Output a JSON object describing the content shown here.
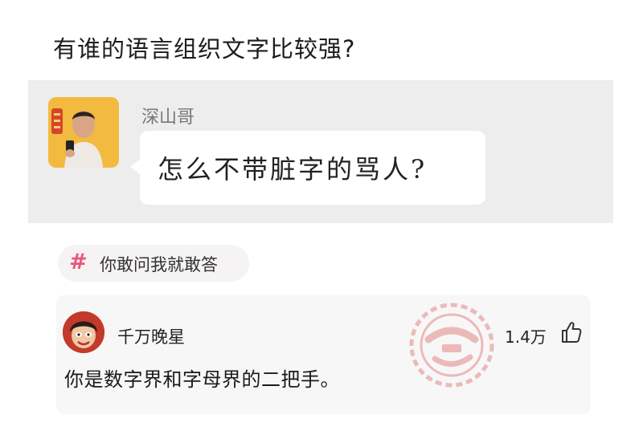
{
  "question": {
    "title": "有谁的语言组织文字比较强?",
    "asker_name": "深山哥",
    "bubble_text": "怎么不带脏字的骂人?"
  },
  "topic": {
    "label": "你敢问我就敢答",
    "icon": "hash-icon"
  },
  "answer": {
    "author": "千万晚星",
    "likes": "1.4万",
    "text": "你是数字界和字母界的二把手。"
  },
  "watermark": {
    "icon": "stamp-watermark"
  },
  "colors": {
    "panel_bg": "#ededed",
    "accent_pink": "#e8567a",
    "watermark_red": "#d63a3a"
  }
}
